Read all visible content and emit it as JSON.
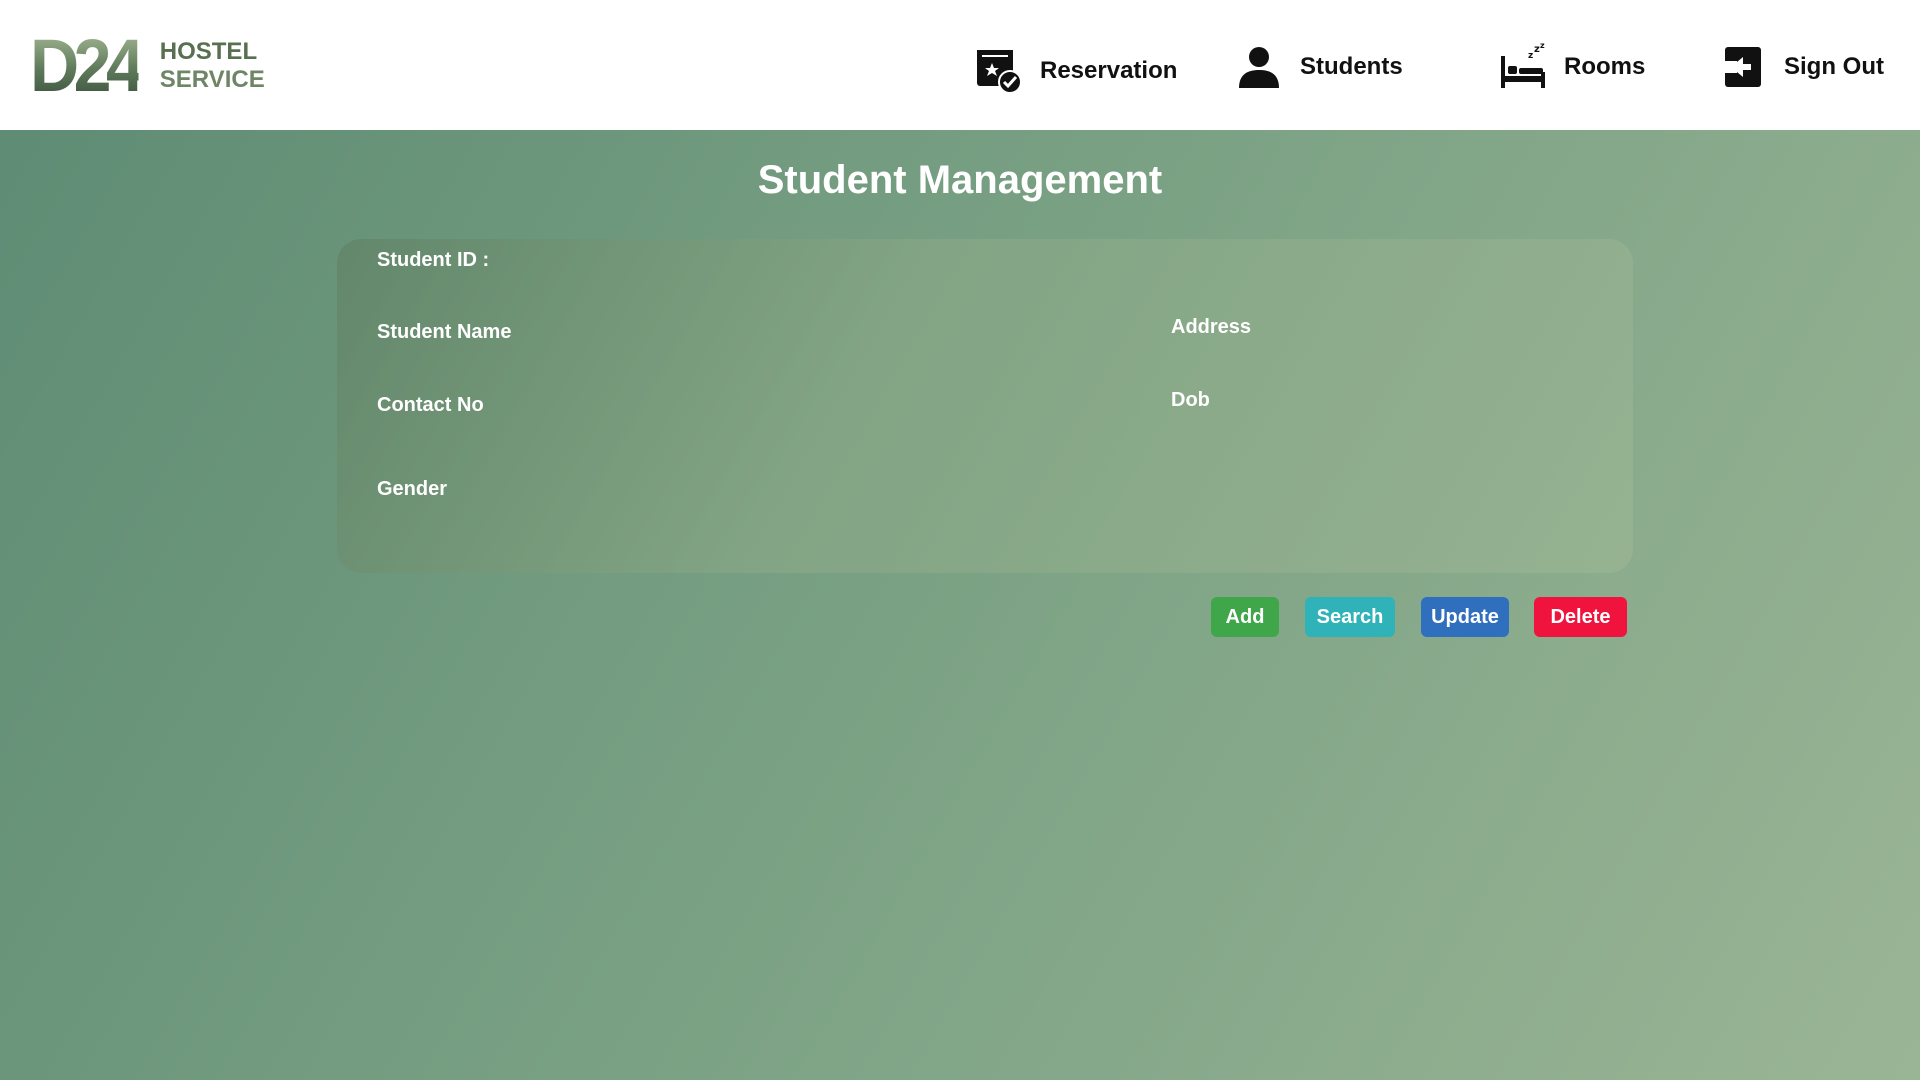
{
  "header": {
    "logo_mark": "D24",
    "logo_line1": "HOSTEL",
    "logo_line2": "SERVICE",
    "nav": {
      "reservation": "Reservation",
      "students": "Students",
      "rooms": "Rooms",
      "signout": "Sign Out"
    }
  },
  "main": {
    "title": "Student Management",
    "fields": {
      "student_id": "Student ID :",
      "student_name": "Student Name",
      "contact_no": "Contact No",
      "gender": "Gender",
      "address": "Address",
      "dob": "Dob"
    },
    "values": {
      "student_id": "",
      "student_name": "",
      "contact_no": "",
      "gender": "",
      "address": "",
      "dob": ""
    },
    "buttons": {
      "add": "Add",
      "search": "Search",
      "update": "Update",
      "delete": "Delete"
    }
  },
  "colors": {
    "add": "#3fa64a",
    "search": "#2fb2b8",
    "update": "#2f6fbd",
    "delete": "#f0133d"
  }
}
